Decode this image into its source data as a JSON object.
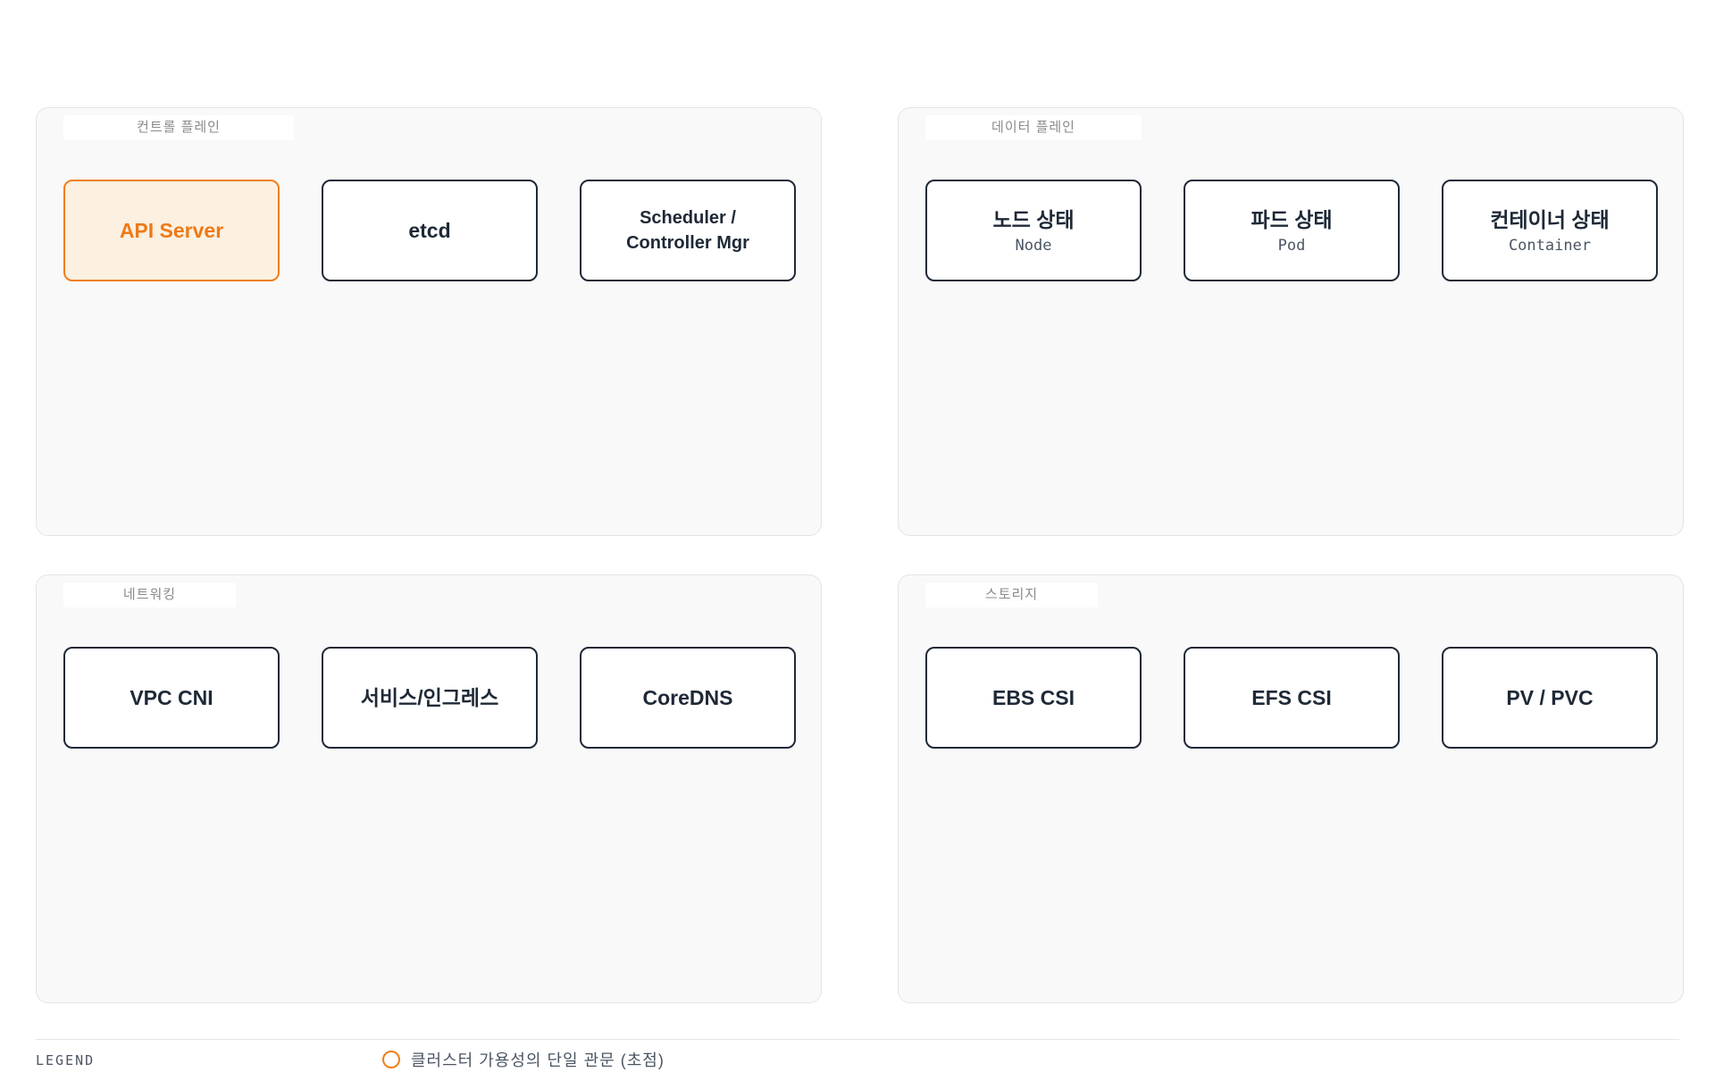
{
  "panels": [
    {
      "label": "컨트롤 플레인",
      "nodes": [
        {
          "title": "API Server",
          "sub": ""
        },
        {
          "title": "etcd",
          "sub": ""
        },
        {
          "title": "Scheduler /\nController Mgr",
          "sub": ""
        }
      ]
    },
    {
      "label": "데이터 플레인",
      "nodes": [
        {
          "title": "노드 상태",
          "sub": "Node"
        },
        {
          "title": "파드 상태",
          "sub": "Pod"
        },
        {
          "title": "컨테이너 상태",
          "sub": "Container"
        }
      ]
    },
    {
      "label": "네트워킹",
      "nodes": [
        {
          "title": "VPC CNI",
          "sub": ""
        },
        {
          "title": "서비스/인그레스",
          "sub": ""
        },
        {
          "title": "CoreDNS",
          "sub": ""
        }
      ]
    },
    {
      "label": "스토리지",
      "nodes": [
        {
          "title": "EBS CSI",
          "sub": ""
        },
        {
          "title": "EFS CSI",
          "sub": ""
        },
        {
          "title": "PV / PVC",
          "sub": ""
        }
      ]
    }
  ],
  "legend": {
    "title": "LEGEND",
    "items": [
      {
        "label": "클러스터 가용성의 단일 관문 (초점)",
        "color": "#f07e1a"
      }
    ]
  },
  "colors": {
    "focus_border": "#f07e1a",
    "focus_fill": "#fcf0e1",
    "node_border": "#1f2937",
    "panel_fill": "#f9f9f9"
  }
}
